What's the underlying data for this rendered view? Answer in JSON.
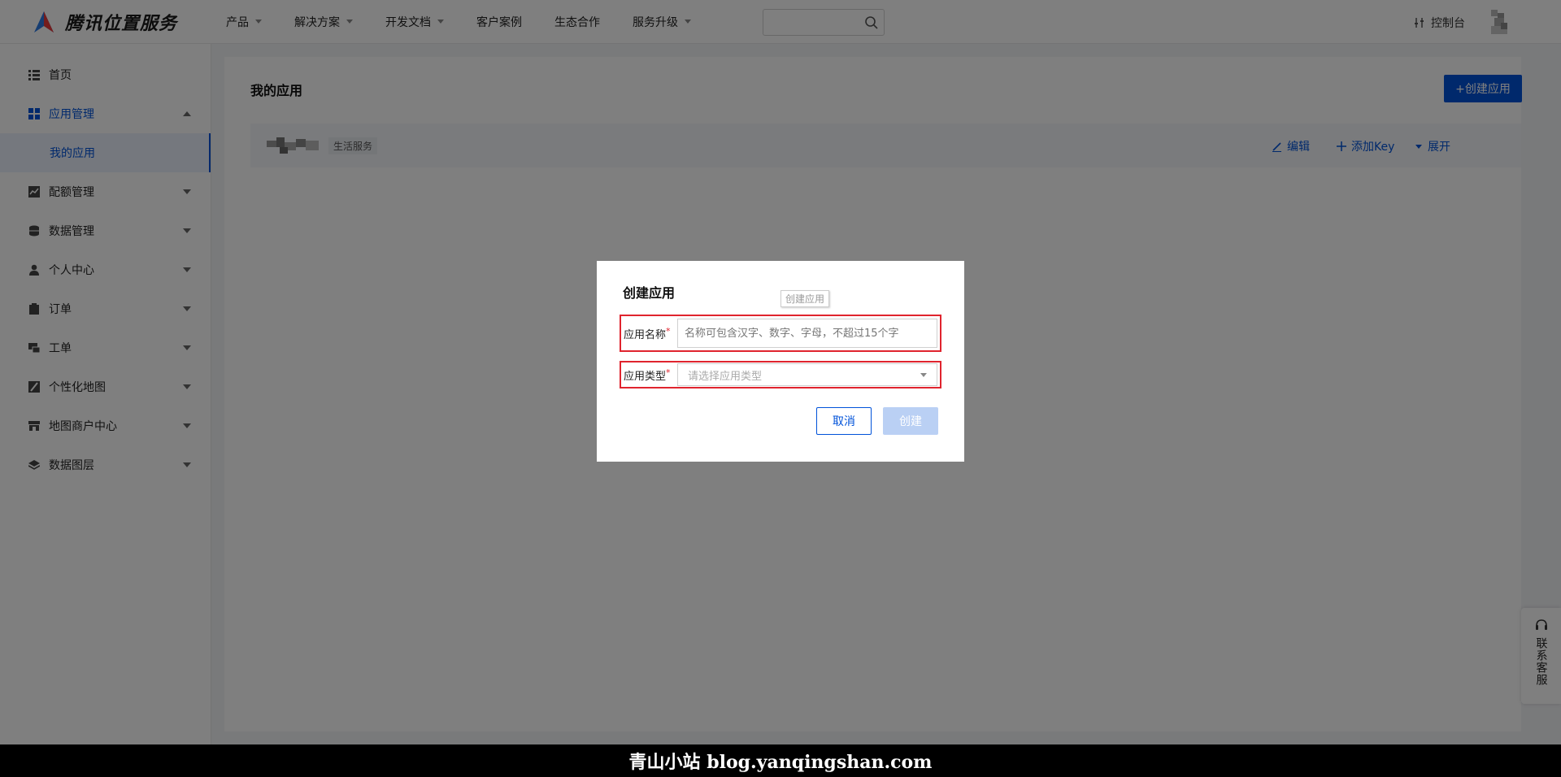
{
  "header": {
    "brand": "腾讯位置服务",
    "nav": [
      {
        "label": "产品",
        "has_dropdown": true
      },
      {
        "label": "解决方案",
        "has_dropdown": true
      },
      {
        "label": "开发文档",
        "has_dropdown": true
      },
      {
        "label": "客户案例",
        "has_dropdown": false
      },
      {
        "label": "生态合作",
        "has_dropdown": false
      },
      {
        "label": "服务升级",
        "has_dropdown": true
      }
    ],
    "search_value": "",
    "console_label": "控制台"
  },
  "sidebar": {
    "items": [
      {
        "label": "首页",
        "icon": "list-icon"
      },
      {
        "label": "应用管理",
        "icon": "grid-icon",
        "expanded": true
      },
      {
        "label": "我的应用",
        "sub": true,
        "selected": true
      },
      {
        "label": "配额管理",
        "icon": "chart-icon"
      },
      {
        "label": "数据管理",
        "icon": "database-icon"
      },
      {
        "label": "个人中心",
        "icon": "user-icon"
      },
      {
        "label": "订单",
        "icon": "clipboard-icon"
      },
      {
        "label": "工单",
        "icon": "ticket-icon"
      },
      {
        "label": "个性化地图",
        "icon": "map-style-icon"
      },
      {
        "label": "地图商户中心",
        "icon": "store-icon"
      },
      {
        "label": "数据图层",
        "icon": "layers-icon"
      }
    ]
  },
  "main": {
    "title": "我的应用",
    "create_button": "+创建应用",
    "app_row": {
      "tag": "生活服务",
      "edit": "编辑",
      "add_key": "添加Key",
      "expand": "展开"
    }
  },
  "support": {
    "label": "联系客服"
  },
  "dialog": {
    "title": "创建应用",
    "tooltip": "创建应用",
    "name_label": "应用名称",
    "name_placeholder": "名称可包含汉字、数字、字母，不超过15个字",
    "type_label": "应用类型",
    "type_placeholder": "请选择应用类型",
    "cancel": "取消",
    "create": "创建"
  },
  "footer_watermark": "青山小站 blog.yanqingshan.com",
  "colors": {
    "accent": "#0052d9",
    "required": "#e0242e",
    "disabled_btn": "#bad0f4"
  }
}
